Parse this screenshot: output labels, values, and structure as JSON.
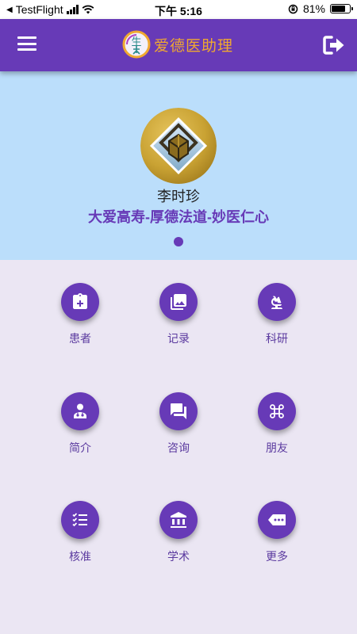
{
  "status_bar": {
    "back_app": "TestFlight",
    "time": "下午 5:16",
    "battery": "81%",
    "battery_level": 0.81
  },
  "app_bar": {
    "title": "爱德医助理",
    "menu_icon": "hamburger-menu-icon",
    "logout_icon": "logout-icon"
  },
  "hero": {
    "name": "李时珍",
    "motto": "大爱高寿-厚德法道-妙医仁心",
    "page_count": 1,
    "active_page": 1
  },
  "menu": [
    {
      "label": "患者",
      "icon": "clipboard-plus-icon"
    },
    {
      "label": "记录",
      "icon": "photo-library-icon"
    },
    {
      "label": "科研",
      "icon": "microscope-icon"
    },
    {
      "label": "简介",
      "icon": "doctor-icon"
    },
    {
      "label": "咨询",
      "icon": "chat-icon"
    },
    {
      "label": "朋友",
      "icon": "command-icon"
    },
    {
      "label": "核准",
      "icon": "checklist-icon"
    },
    {
      "label": "学术",
      "icon": "institution-icon"
    },
    {
      "label": "更多",
      "icon": "more-tag-icon"
    }
  ],
  "colors": {
    "primary": "#673ab7",
    "hero_bg": "#bbdefb",
    "body_bg": "#ebe6f3",
    "brand_text": "#f0a830"
  }
}
